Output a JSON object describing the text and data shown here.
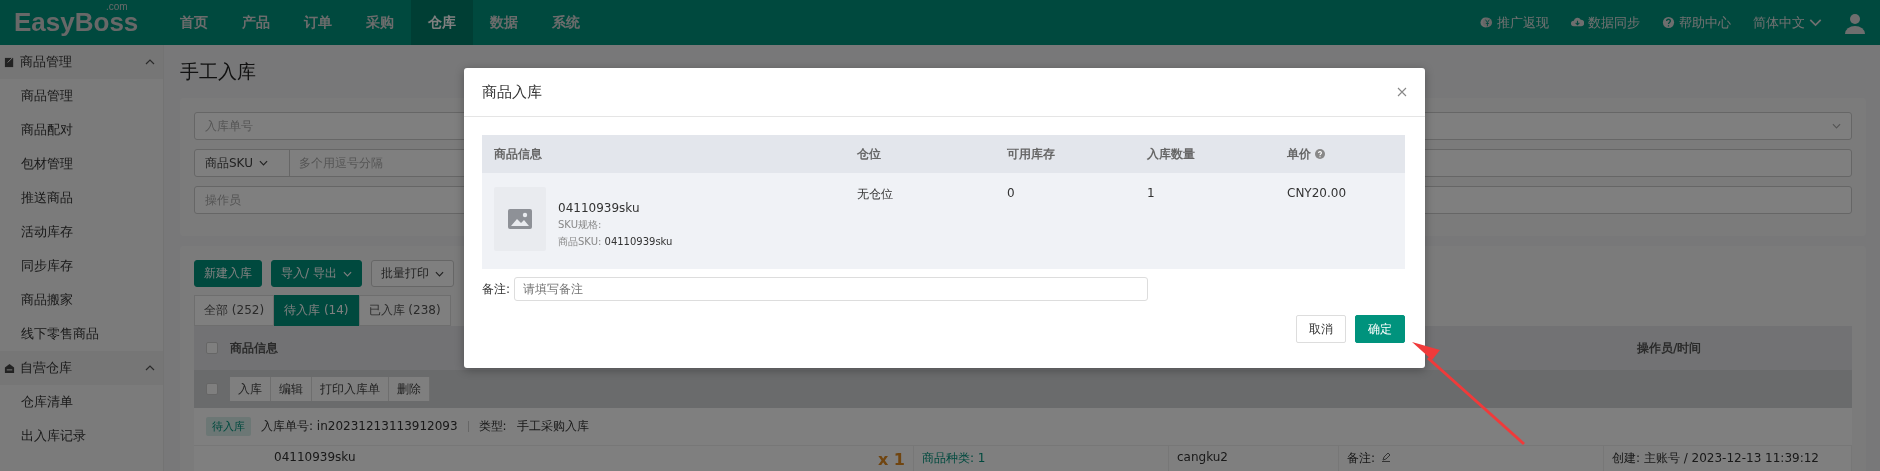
{
  "topbar": {
    "logo": "EasyBoss",
    "logo_suffix": ".com",
    "nav": [
      {
        "label": "首页",
        "selected": false
      },
      {
        "label": "产品",
        "selected": false
      },
      {
        "label": "订单",
        "selected": false
      },
      {
        "label": "采购",
        "selected": false
      },
      {
        "label": "仓库",
        "selected": true
      },
      {
        "label": "数据",
        "selected": false
      },
      {
        "label": "系统",
        "selected": false
      }
    ],
    "tools": [
      {
        "kind": "coin",
        "label": "推广返现"
      },
      {
        "kind": "cloud",
        "label": "数据同步"
      },
      {
        "kind": "help",
        "label": "帮助中心"
      },
      {
        "kind": "language",
        "label": "简体中文"
      }
    ]
  },
  "sidebar": {
    "groups": [
      {
        "kind": "goods",
        "title": "商品管理",
        "expanded": true,
        "items": [
          "商品管理",
          "商品配对",
          "包材管理",
          "推送商品",
          "活动库存",
          "同步库存",
          "商品搬家",
          "线下零售商品"
        ]
      },
      {
        "kind": "warehouse",
        "title": "自营仓库",
        "expanded": true,
        "items": [
          "仓库清单",
          "出入库记录"
        ]
      }
    ]
  },
  "page": {
    "title": "手工入库",
    "filters": {
      "order_no_placeholder": "入库单号",
      "sku_select": "商品SKU",
      "sku_placeholder": "多个用逗号分隔",
      "operator_placeholder": "操作员"
    },
    "toolbar": [
      {
        "kind": "primary",
        "label": "新建入库"
      },
      {
        "kind": "primary-dropdown",
        "label": "导入/ 导出"
      },
      {
        "kind": "dropdown",
        "label": "批量打印"
      }
    ],
    "tabs": [
      {
        "label": "全部 (252)",
        "selected": false
      },
      {
        "label": "待入库 (14)",
        "selected": true
      },
      {
        "label": "已入库 (238)",
        "selected": false
      }
    ],
    "table": {
      "columns": [
        "商品信息",
        "操作员/时间"
      ],
      "header_checked": false,
      "bulk_checked": false,
      "bulk_actions": [
        "入库",
        "编辑",
        "打印入库单",
        "删除"
      ],
      "order": {
        "status": "待入库",
        "order_no": "入库单号: in20231213113912093",
        "type_label": "类型:",
        "type": "手工采购入库"
      },
      "row": {
        "sku": "04110939sku",
        "qty": "x 1",
        "kinds": "商品种类: 1",
        "warehouse": "cangku2",
        "remark_label": "备注:",
        "created": "创建: 主账号 / 2023-12-13 11:39:12"
      }
    }
  },
  "modal": {
    "title": "商品入库",
    "columns": [
      "商品信息",
      "仓位",
      "可用库存",
      "入库数量",
      "单价"
    ],
    "rows": [
      {
        "sku": "04110939sku",
        "spec": "SKU规格:",
        "sku_label": "商品SKU:",
        "sku_value": "04110939sku",
        "location": "无仓位",
        "available": "0",
        "quantity": "1",
        "price": "CNY20.00"
      }
    ],
    "remark_label": "备注:",
    "remark_placeholder": "请填写备注",
    "buttons": [
      {
        "kind": "default",
        "label": "取消"
      },
      {
        "kind": "primary",
        "label": "确定"
      }
    ]
  }
}
